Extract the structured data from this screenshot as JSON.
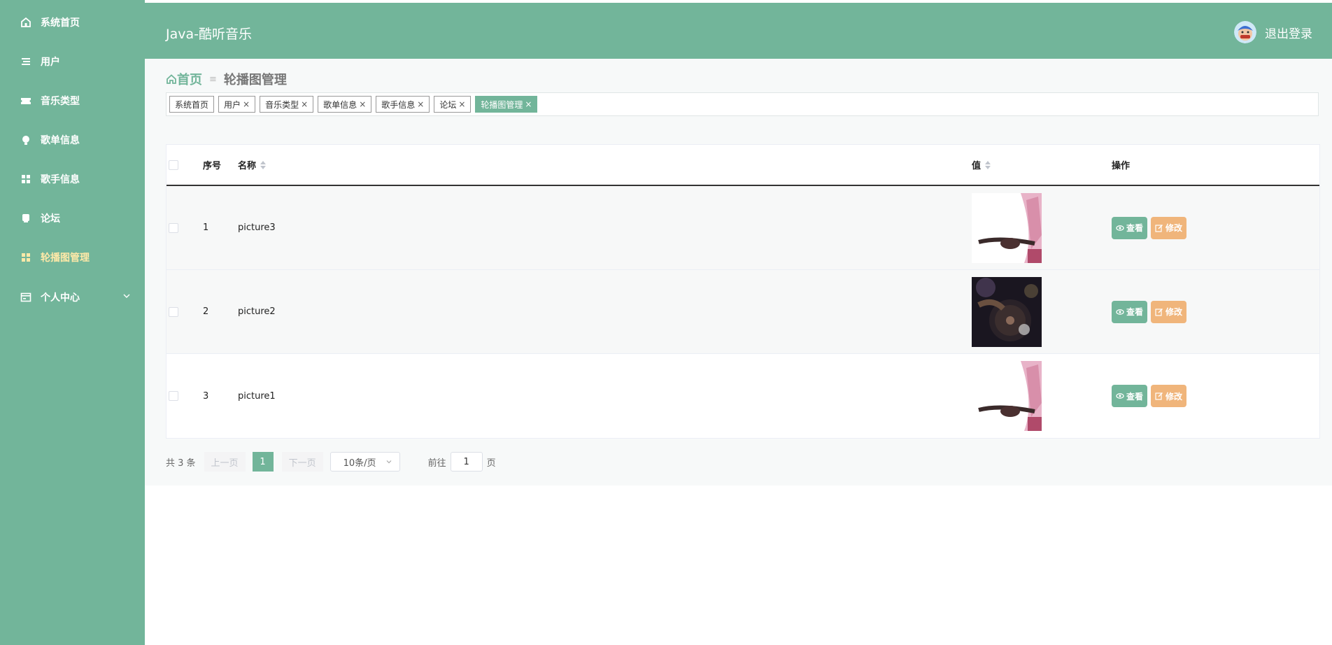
{
  "sidebar": {
    "items": [
      {
        "label": "系统首页",
        "icon": "home-icon"
      },
      {
        "label": "用户",
        "icon": "list-icon"
      },
      {
        "label": "音乐类型",
        "icon": "ticket-icon"
      },
      {
        "label": "歌单信息",
        "icon": "bulb-icon"
      },
      {
        "label": "歌手信息",
        "icon": "grid-icon"
      },
      {
        "label": "论坛",
        "icon": "chat-icon"
      },
      {
        "label": "轮播图管理",
        "icon": "grid-icon",
        "active": true
      },
      {
        "label": "个人中心",
        "icon": "card-icon"
      }
    ]
  },
  "header": {
    "title": "Java-酷听音乐",
    "logout_label": "退出登录"
  },
  "breadcrumb": {
    "home": "首页",
    "current": "轮播图管理"
  },
  "tags": [
    "系统首页",
    "用户",
    "音乐类型",
    "歌单信息",
    "歌手信息",
    "论坛",
    "轮播图管理"
  ],
  "table": {
    "headers": {
      "index": "序号",
      "name": "名称",
      "value": "值",
      "actions": "操作"
    },
    "rows": [
      {
        "index": "1",
        "name": "picture3"
      },
      {
        "index": "2",
        "name": "picture2"
      },
      {
        "index": "3",
        "name": "picture1"
      }
    ],
    "view_label": "查看",
    "edit_label": "修改"
  },
  "pagination": {
    "total": "共 3 条",
    "prev": "上一页",
    "current_page": "1",
    "next": "下一页",
    "page_size": "10条/页",
    "goto_label": "前往",
    "goto_value": "1",
    "page_suffix": "页"
  },
  "colors": {
    "primary": "#72b59a",
    "edit": "#f0b57b",
    "active_menu": "#ffe9a8"
  }
}
